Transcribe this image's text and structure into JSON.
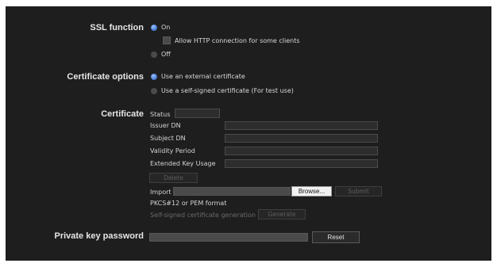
{
  "ssl": {
    "label": "SSL function",
    "on_label": "On",
    "allow_http_label": "Allow HTTP connection for some clients",
    "off_label": "Off",
    "selected": "on",
    "allow_http_checked": false
  },
  "cert_options": {
    "label": "Certificate options",
    "external_label": "Use an external certificate",
    "self_signed_label": "Use a self-signed certificate (For test use)",
    "selected": "external"
  },
  "certificate": {
    "label": "Certificate",
    "status_label": "Status",
    "status_value": "",
    "issuer_label": "Issuer DN",
    "issuer_value": "",
    "subject_label": "Subject DN",
    "subject_value": "",
    "validity_label": "Validity Period",
    "validity_value": "",
    "eku_label": "Extended Key Usage",
    "eku_value": "",
    "delete_label": "Delete",
    "import_label": "Import",
    "import_value": "",
    "browse_label": "Browse...",
    "submit_label": "Submit",
    "format_note": "PKCS#12 or PEM format",
    "self_signed_gen_label": "Self-signed certificate generation",
    "generate_label": "Generate"
  },
  "private_key": {
    "label": "Private key password",
    "value": "",
    "reset_label": "Reset"
  },
  "colors": {
    "panel_bg": "#1e1e1e",
    "radio_selected": "#4d7fd6",
    "field_bg": "#2d2d2d"
  }
}
